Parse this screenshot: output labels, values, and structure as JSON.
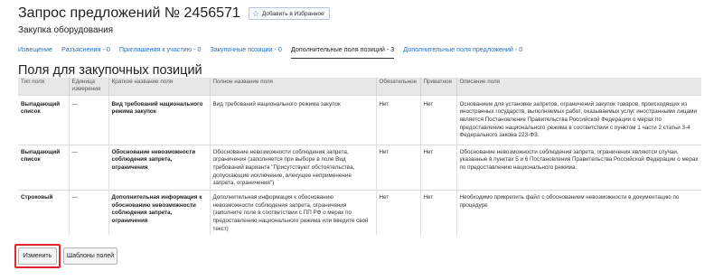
{
  "header": {
    "title": "Запрос предложений № 2456571",
    "favorite_label": "Добавить в Избранное",
    "subtitle": "Закупка оборудования"
  },
  "tabs": [
    {
      "label": "Извещение",
      "active": false
    },
    {
      "label": "Разъяснения - 0",
      "active": false
    },
    {
      "label": "Приглашения к участию - 0",
      "active": false
    },
    {
      "label": "Закупочные позиции - 0",
      "active": false
    },
    {
      "label": "Дополнительные поля позиций - 3",
      "active": true
    },
    {
      "label": "Дополнительные поля предложений - 0",
      "active": false
    }
  ],
  "section_title": "Поля для закупочных позиций",
  "table": {
    "columns": [
      "Тип поля",
      "Единица измерения",
      "Краткое название поля",
      "Полное название поля",
      "Обязательное",
      "Приватное",
      "Описание поля"
    ],
    "rows": [
      [
        "Выпадающий список",
        "—",
        "Вид требований национального режима закупок",
        "Вид требований национального режима закупок",
        "Нет",
        "Нет",
        "Основанием для установки запретов, ограничений закупок товаров, происходящих из иностранных государств, выполняемых работ, оказываемых услуг иностранными лицами является Постановление Правительства Российской Федерации о мерах по предоставлению национального режима в соответствии с пунктом 1 части 2 статьи 3-4 Федерального закона 223-ФЗ."
      ],
      [
        "Выпадающий список",
        "—",
        "Обоснование невозможности соблюдения запрета, ограничения",
        "Обоснование невозможности соблюдения запрета, ограничения (заполняется при выборе в поле Вид требований варианта \"Присутствуют обстоятельства, допускающие исключение, влекущее неприменение запрета, ограничения\")",
        "Нет",
        "Нет",
        "Обоснование невозможности соблюдения запрета, ограничения являются случаи, указанные в пунктах 5 и 6 Постановления Правительства Российской Федерации о мерах по предоставлению национального режима."
      ],
      [
        "Строковый",
        "—",
        "Дополнительная информация к обоснованию невозможности соблюдения запрета, ограничения",
        "Дополнительная информация к обоснованию невозможности соблюдения запрета, ограничения (заполните поле в соответствии с ПП РФ о мерах по предоставлению национального режима или введите свой текст)",
        "Нет",
        "Нет",
        "Необходимо прикрепить файл с обоснованием невозможности в документацию по процедуре"
      ]
    ]
  },
  "buttons": {
    "edit": "Изменить",
    "templates": "Шаблоны полей"
  },
  "colors": {
    "link": "#2a6fb8",
    "highlight": "#e0262a",
    "header_bg": "#e7e7e7"
  }
}
